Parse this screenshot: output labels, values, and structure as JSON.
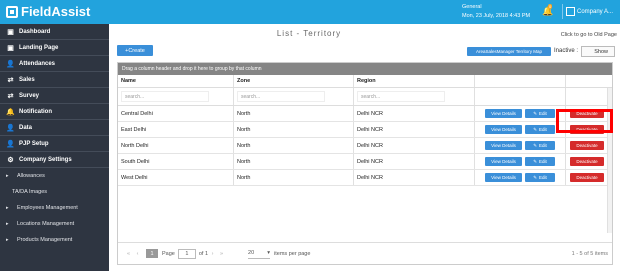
{
  "header": {
    "brand": "FieldAssist",
    "user_name": "General",
    "datetime": "Mon, 23 July, 2018 4:43 PM",
    "notification_count": "0",
    "company": "Company A..."
  },
  "sidebar": {
    "items": [
      {
        "label": "Dashboard",
        "icon": "dashboard-icon",
        "glyph": "▣"
      },
      {
        "label": "Landing Page",
        "icon": "landing-icon",
        "glyph": "▣"
      },
      {
        "label": "Attendances",
        "icon": "user-icon",
        "glyph": "👤"
      },
      {
        "label": "Sales",
        "icon": "sales-icon",
        "glyph": "⇄"
      },
      {
        "label": "Survey",
        "icon": "survey-icon",
        "glyph": "⇄"
      },
      {
        "label": "Notification",
        "icon": "notification-icon",
        "glyph": "🔔"
      },
      {
        "label": "Data",
        "icon": "data-icon",
        "glyph": "👤"
      },
      {
        "label": "PJP Setup",
        "icon": "pjp-icon",
        "glyph": "👤"
      },
      {
        "label": "Company Settings",
        "icon": "settings-icon",
        "glyph": "⚙"
      }
    ],
    "subitems": [
      {
        "label": "Allowances",
        "arrow": "▸"
      },
      {
        "label": "TA/DA Images",
        "arrow": ""
      },
      {
        "label": "Employees Management",
        "arrow": "▸"
      },
      {
        "label": "Locations Management",
        "arrow": "▸"
      },
      {
        "label": "Products Management",
        "arrow": "▸"
      }
    ]
  },
  "main": {
    "title": "List - Territory",
    "old_page_link": "Click to go to Old Page",
    "create_label": "+Create",
    "territory_mgr_label": "AreaSalesManager Territory Map",
    "inactive_label": "Inactive :",
    "show_label": "Show",
    "group_hint": "Drag a column header and drop it here to group by that column"
  },
  "table": {
    "columns": [
      "Name",
      "Zone",
      "Region"
    ],
    "search_placeholder": "search...",
    "view_label": "View Details",
    "edit_label": "Edit",
    "deactivate_label": "Deactivate",
    "rows": [
      {
        "name": "Central Delhi",
        "zone": "North",
        "region": "Delhi NCR"
      },
      {
        "name": "East Delhi",
        "zone": "North",
        "region": "Delhi NCR"
      },
      {
        "name": "North Delhi",
        "zone": "North",
        "region": "Delhi NCR"
      },
      {
        "name": "South Delhi",
        "zone": "North",
        "region": "Delhi NCR"
      },
      {
        "name": "West Delhi",
        "zone": "North",
        "region": "Delhi NCR"
      }
    ]
  },
  "pager": {
    "current": "1",
    "page_label": "Page",
    "page_value": "1",
    "of_label": "of 1",
    "per_page_value": "20",
    "per_page_label": "items per page",
    "summary": "1 - 5 of 5 items"
  }
}
